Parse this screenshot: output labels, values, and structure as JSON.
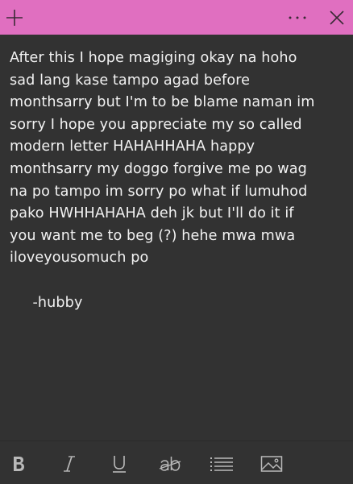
{
  "titlebar": {
    "color": "#e06fc0",
    "icons": {
      "add": "plus-icon",
      "more": "more-horizontal-icon",
      "close": "close-icon"
    }
  },
  "note": {
    "text": "After this I hope magiging okay na hoho\nsad lang kase tampo agad before\nmonthsarry but I'm to be blame naman im\nsorry I hope you appreciate my so called\nmodern letter HAHAHHAHA happy\nmonthsarry my doggo forgive me po wag\nna po tampo im sorry po what if lumuhod\npako HWHHAHAHA deh jk but I'll do it if\nyou want me to beg (?) hehe mwa mwa\niloveyousomuch po\n\n     -hubby"
  },
  "toolbar": {
    "icons": [
      "bold-icon",
      "italic-icon",
      "underline-icon",
      "strikethrough-icon",
      "bullet-list-icon",
      "image-icon"
    ]
  }
}
